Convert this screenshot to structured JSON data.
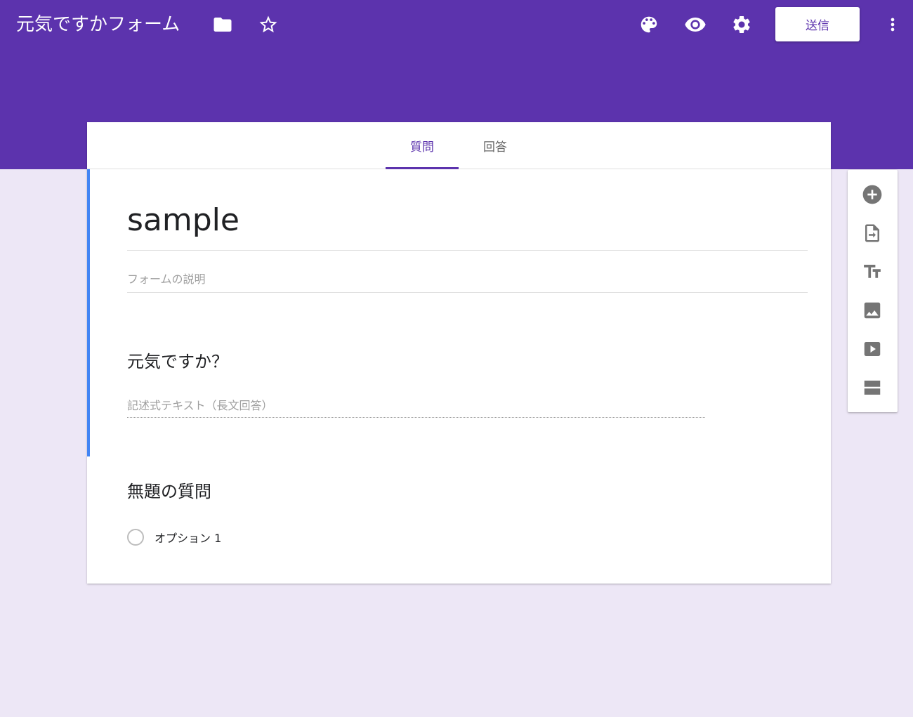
{
  "header": {
    "form_title": "元気ですかフォーム",
    "background_color": "#5c33ad",
    "send_label": "送信",
    "icons": [
      "folder-icon",
      "star-icon",
      "palette-icon",
      "preview-eye-icon",
      "settings-gear-icon",
      "more-vert-icon"
    ]
  },
  "tabs": {
    "questions": "質問",
    "responses": "回答",
    "active": "質問"
  },
  "form": {
    "title": "sample",
    "description_placeholder": "フォームの説明",
    "accent_color": "#4285f4"
  },
  "questions": [
    {
      "title": "元気ですか？",
      "answer_placeholder": "記述式テキスト（長文回答）"
    },
    {
      "title": "無題の質問",
      "options": [
        "オプション 1"
      ]
    }
  ],
  "toolbar": {
    "icons": [
      "add-question-icon",
      "import-questions-icon",
      "add-title-icon",
      "add-image-icon",
      "add-video-icon",
      "add-section-icon"
    ]
  }
}
